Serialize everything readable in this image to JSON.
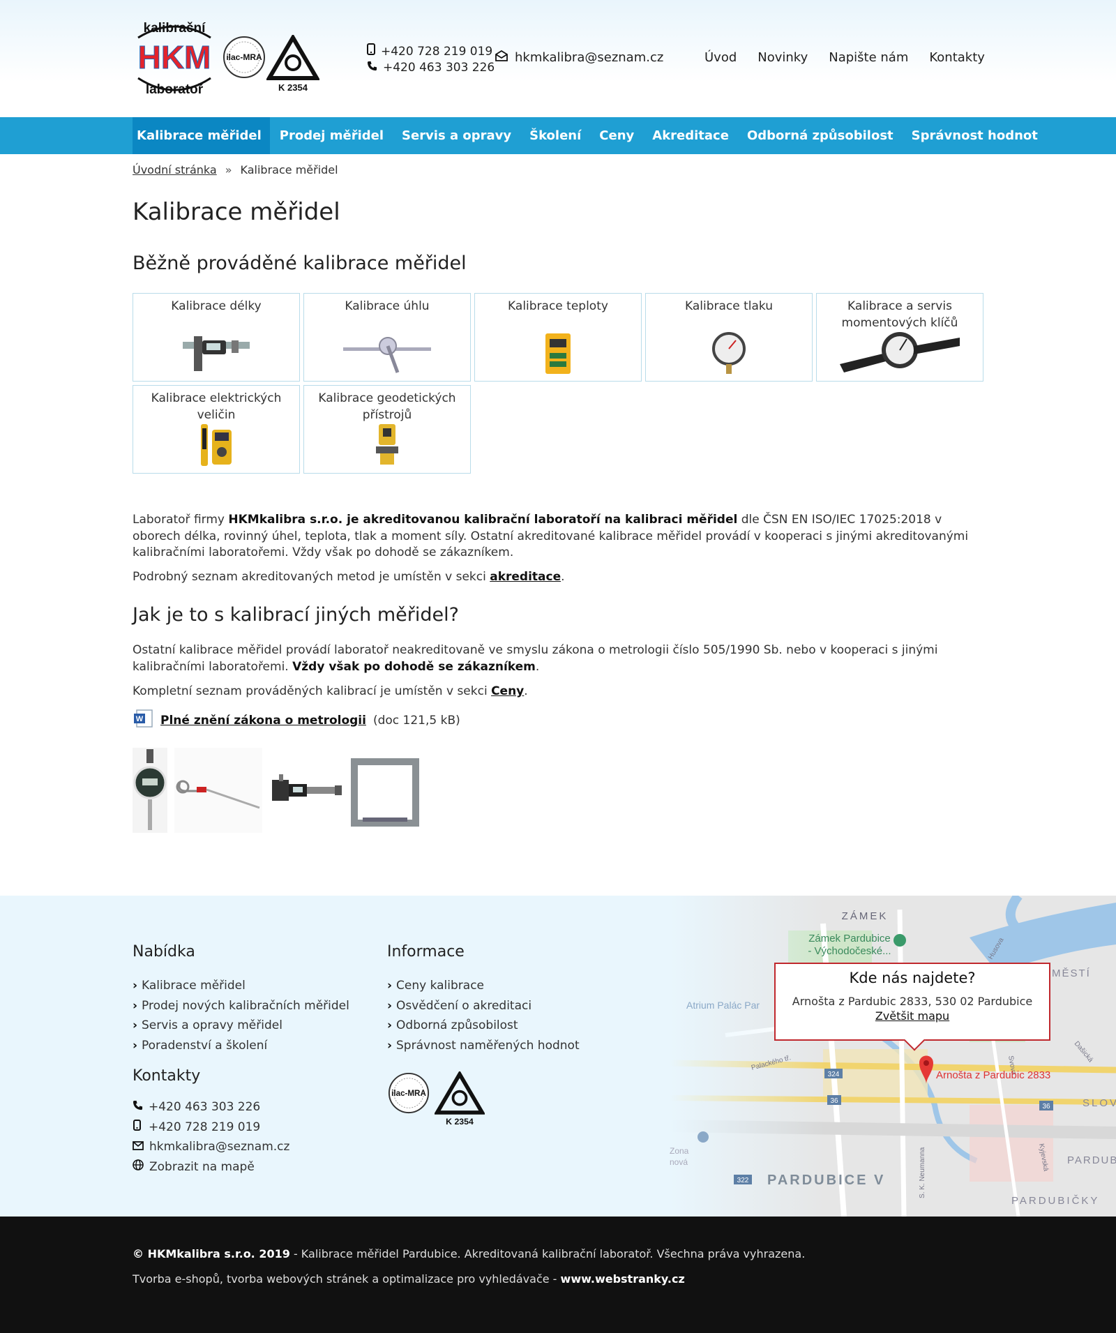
{
  "header": {
    "logo_text_top": "kalibrační",
    "logo_text_mid": "HKM",
    "logo_text_bottom": "laboratoř",
    "ilac_text": "ilac-MRA",
    "accred_code": "K 2354",
    "phone_mobile": "+420 728 219 019",
    "phone_fixed": "+420 463 303 226",
    "email": "hkmkalibra@seznam.cz",
    "top_nav": [
      "Úvod",
      "Novinky",
      "Napište nám",
      "Kontakty"
    ]
  },
  "menu": {
    "items": [
      "Kalibrace měřidel",
      "Prodej měřidel",
      "Servis a opravy",
      "Školení",
      "Ceny",
      "Akreditace",
      "Odborná způsobilost",
      "Správnost hodnot"
    ]
  },
  "breadcrumb": {
    "home": "Úvodní stránka",
    "sep": "»",
    "current": "Kalibrace měřidel"
  },
  "main": {
    "title": "Kalibrace měřidel",
    "subtitle1": "Běžně prováděné kalibrace měřidel",
    "tiles": [
      "Kalibrace délky",
      "Kalibrace úhlu",
      "Kalibrace teploty",
      "Kalibrace tlaku",
      "Kalibrace a servis momentových klíčů",
      "Kalibrace elektrických veličin",
      "Kalibrace geodetických přístrojů"
    ],
    "p1_a": "Laboratoř firmy ",
    "p1_b": "HKMkalibra s.r.o. je akreditovanou kalibrační laboratoří na kalibraci měřidel",
    "p1_c": " dle ČSN EN ISO/IEC 17025:2018 v oborech délka, rovinný úhel, teplota, tlak a moment síly. Ostatní akreditované kalibrace měřidel provádí v kooperaci s jinými akreditovanými kalibračními laboratořemi. Vždy však po dohodě se zákazníkem.",
    "p2_a": "Podrobný seznam akreditovaných metod je umístěn v sekci ",
    "p2_link": "akreditace",
    "p2_end": ".",
    "subtitle2": "Jak je to s kalibrací jiných měřidel?",
    "p3_a": "Ostatní kalibrace měřidel provádí laboratoř neakreditovaně ve smyslu zákona o metrologii číslo 505/1990 Sb. nebo v kooperaci s jinými kalibračními laboratořemi. ",
    "p3_b": "Vždy však po dohodě se zákazníkem",
    "p3_end": ".",
    "p4_a": "Kompletní seznam prováděných kalibrací je umístěn v sekci ",
    "p4_link": "Ceny",
    "p4_end": ".",
    "doc_link": "Plné znění zákona o metrologii",
    "doc_info": "(doc 121,5 kB)",
    "doc_icon_text": "W"
  },
  "footer": {
    "nabidka_title": "Nabídka",
    "nabidka": [
      "Kalibrace měřidel",
      "Prodej nových kalibračních měřidel",
      "Servis a opravy měřidel",
      "Poradenství a školení"
    ],
    "informace_title": "Informace",
    "informace": [
      "Ceny kalibrace",
      "Osvědčení o akreditaci",
      "Odborná způsobilost",
      "Správnost naměřených hodnot"
    ],
    "kontakty_title": "Kontakty",
    "phone_fixed": "+420 463 303 226",
    "phone_mobile": "+420 728 219 019",
    "email": "hkmkalibra@seznam.cz",
    "map_link": "Zobrazit na mapě",
    "mapbox_title": "Kde nás najdete?",
    "mapbox_address": "Arnošta z Pardubic 2833, 530 02 Pardubice",
    "mapbox_link": "Zvětšit mapu",
    "map_labels": {
      "zamek": "ZÁMEK",
      "zamek_pardubice": "Zámek Pardubice",
      "vychodoceske": "- Východočeské...",
      "atrium": "Atrium Palác Par",
      "mesti": "MĚSTÍ",
      "husova": "Husova",
      "palackeho": "Palackého tř.",
      "pin_label": "Arnošta z Pardubic 2833",
      "r324": "324",
      "r36a": "36",
      "r36b": "36",
      "r322": "322",
      "slov": "SLOV",
      "pardubice_v": "PARDUBICE V",
      "pardubic": "PARDUBIC",
      "pardubicky": "PARDUBIČKY",
      "neumanna": "S. K. Neumanna",
      "kyjevska": "Kyjevská",
      "desticka": "Dašická",
      "svova": "Svova",
      "zona": "Zona",
      "zona2": "nová"
    }
  },
  "bottom": {
    "copy": "© HKMkalibra s.r.o. 2019",
    "copy_rest": " - Kalibrace měřidel Pardubice. Akreditovaná kalibrační laboratoř. Všechna práva vyhrazena.",
    "credit": "Tvorba e-shopů, tvorba webových stránek a optimalizace pro vyhledávače - ",
    "credit_link": "www.webstranky.cz"
  }
}
